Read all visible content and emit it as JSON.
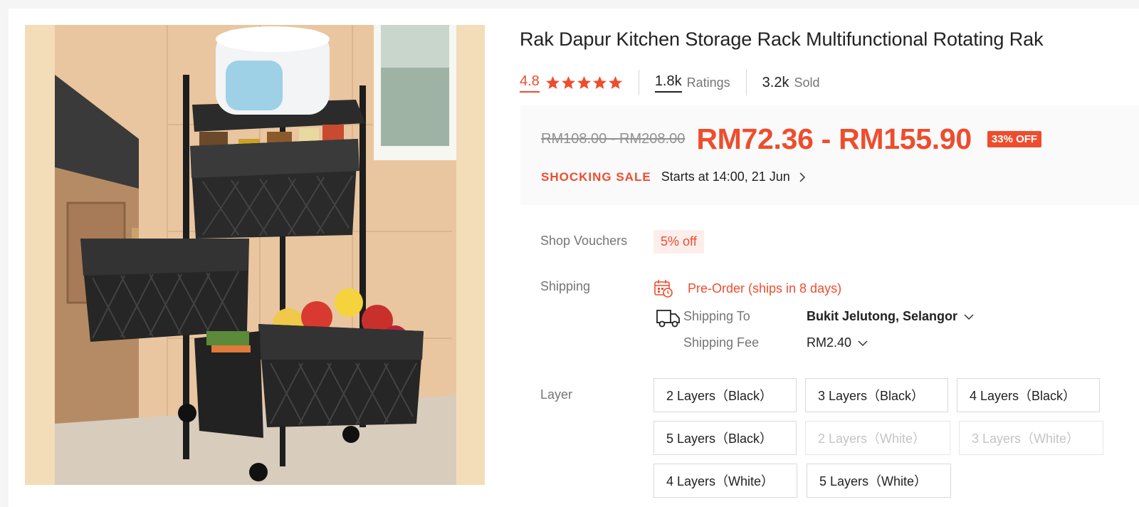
{
  "product": {
    "title": "Rak Dapur Kitchen Storage Rack Multifunctional Rotating Rak",
    "rating": "4.8",
    "ratings_count": "1.8k",
    "ratings_label": "Ratings",
    "sold_count": "3.2k",
    "sold_label": "Sold",
    "star_count": 5
  },
  "price": {
    "original": "RM108.00 - RM208.00",
    "current": "RM72.36 - RM155.90",
    "discount": "33% OFF",
    "sale_label": "SHOCKING SALE",
    "sale_start": "Starts at 14:00, 21 Jun"
  },
  "vouchers": {
    "label": "Shop Vouchers",
    "tag": "5% off"
  },
  "shipping": {
    "label": "Shipping",
    "preorder": "Pre-Order (ships in 8 days)",
    "to_label": "Shipping To",
    "to_value": "Bukit Jelutong, Selangor",
    "fee_label": "Shipping Fee",
    "fee_value": "RM2.40"
  },
  "layer": {
    "label": "Layer",
    "options": [
      {
        "label": "2 Layers（Black）",
        "available": true
      },
      {
        "label": "3 Layers（Black）",
        "available": true
      },
      {
        "label": "4 Layers（Black）",
        "available": true
      },
      {
        "label": "5 Layers（Black）",
        "available": true
      },
      {
        "label": "2 Layers（White）",
        "available": false
      },
      {
        "label": "3 Layers（White）",
        "available": false
      },
      {
        "label": "4 Layers（White）",
        "available": true
      },
      {
        "label": "5 Layers（White）",
        "available": true
      }
    ]
  },
  "colors": {
    "accent": "#ee4d2d",
    "voucher_bg": "#fdeeec",
    "price_box_bg": "#fafafa",
    "image_bg": "#f3dcb8"
  },
  "icons": {
    "star": "star-icon",
    "sale_chevron": "chevron-right-icon",
    "preorder": "calendar-clock-icon",
    "shipping": "truck-icon",
    "dropdown": "chevron-down-icon"
  }
}
